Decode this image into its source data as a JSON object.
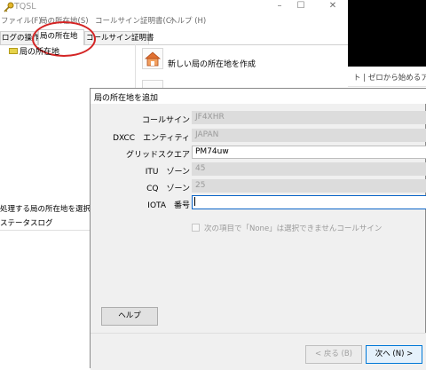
{
  "app": {
    "title": "TQSL"
  },
  "window_controls": {
    "minimize": "–",
    "maximize": "☐",
    "close": "✕"
  },
  "menu": {
    "items": [
      "ファイル(F)",
      "局の所在地(S)",
      "コールサイン証明書(C)",
      "ヘルプ (H)"
    ]
  },
  "tabs": [
    {
      "label": "ログの操作"
    },
    {
      "label": "局の所在地"
    },
    {
      "label": "コールサイン証明書"
    }
  ],
  "tree": {
    "item_label": "局の所在地"
  },
  "actions": {
    "new_location_label": "新しい局の所在地を作成"
  },
  "left_panel": {
    "select_prompt": "処理する局の所在地を選択",
    "status_label": "ステータスログ"
  },
  "browser": {
    "text": "ト | ゼロから始めるアマチ"
  },
  "dialog": {
    "title": "局の所在地を追加",
    "fields": {
      "callsign": {
        "label": "コールサイン",
        "value": "JF4XHR"
      },
      "dxcc": {
        "label": "DXCC　エンティティ",
        "value": "JAPAN"
      },
      "grid": {
        "label": "グリッドスクエア",
        "value": "PM74uw"
      },
      "itu": {
        "label": "ITU　ゾーン",
        "value": "45"
      },
      "cq": {
        "label": "CQ　ゾーン",
        "value": "25"
      },
      "iota": {
        "label": "IOTA　番号",
        "value": ""
      }
    },
    "none_option_label": "次の項目で「None」は選択できませんコールサイン",
    "help_button": "ヘルプ",
    "back_button": "< 戻る (B)",
    "next_button": "次へ (N) >"
  },
  "colors": {
    "highlight_circle": "#d42424",
    "focus_border": "#0a64c8",
    "readonly_field": "#dcdcdc",
    "dialog_bg": "#f0f0f0"
  }
}
